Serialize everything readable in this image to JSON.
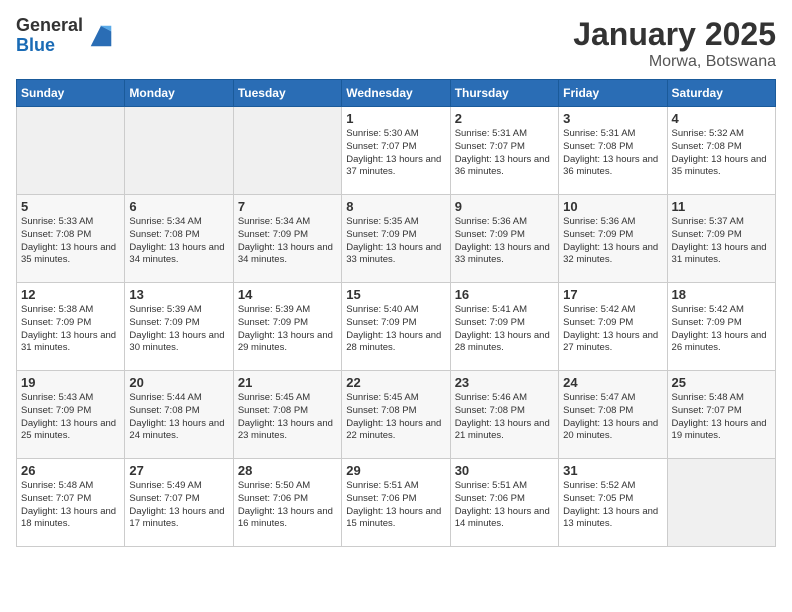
{
  "header": {
    "logo_line1": "General",
    "logo_line2": "Blue",
    "title": "January 2025",
    "subtitle": "Morwa, Botswana"
  },
  "weekdays": [
    "Sunday",
    "Monday",
    "Tuesday",
    "Wednesday",
    "Thursday",
    "Friday",
    "Saturday"
  ],
  "weeks": [
    [
      {
        "day": "",
        "info": ""
      },
      {
        "day": "",
        "info": ""
      },
      {
        "day": "",
        "info": ""
      },
      {
        "day": "1",
        "info": "Sunrise: 5:30 AM\nSunset: 7:07 PM\nDaylight: 13 hours\nand 37 minutes."
      },
      {
        "day": "2",
        "info": "Sunrise: 5:31 AM\nSunset: 7:07 PM\nDaylight: 13 hours\nand 36 minutes."
      },
      {
        "day": "3",
        "info": "Sunrise: 5:31 AM\nSunset: 7:08 PM\nDaylight: 13 hours\nand 36 minutes."
      },
      {
        "day": "4",
        "info": "Sunrise: 5:32 AM\nSunset: 7:08 PM\nDaylight: 13 hours\nand 35 minutes."
      }
    ],
    [
      {
        "day": "5",
        "info": "Sunrise: 5:33 AM\nSunset: 7:08 PM\nDaylight: 13 hours\nand 35 minutes."
      },
      {
        "day": "6",
        "info": "Sunrise: 5:34 AM\nSunset: 7:08 PM\nDaylight: 13 hours\nand 34 minutes."
      },
      {
        "day": "7",
        "info": "Sunrise: 5:34 AM\nSunset: 7:09 PM\nDaylight: 13 hours\nand 34 minutes."
      },
      {
        "day": "8",
        "info": "Sunrise: 5:35 AM\nSunset: 7:09 PM\nDaylight: 13 hours\nand 33 minutes."
      },
      {
        "day": "9",
        "info": "Sunrise: 5:36 AM\nSunset: 7:09 PM\nDaylight: 13 hours\nand 33 minutes."
      },
      {
        "day": "10",
        "info": "Sunrise: 5:36 AM\nSunset: 7:09 PM\nDaylight: 13 hours\nand 32 minutes."
      },
      {
        "day": "11",
        "info": "Sunrise: 5:37 AM\nSunset: 7:09 PM\nDaylight: 13 hours\nand 31 minutes."
      }
    ],
    [
      {
        "day": "12",
        "info": "Sunrise: 5:38 AM\nSunset: 7:09 PM\nDaylight: 13 hours\nand 31 minutes."
      },
      {
        "day": "13",
        "info": "Sunrise: 5:39 AM\nSunset: 7:09 PM\nDaylight: 13 hours\nand 30 minutes."
      },
      {
        "day": "14",
        "info": "Sunrise: 5:39 AM\nSunset: 7:09 PM\nDaylight: 13 hours\nand 29 minutes."
      },
      {
        "day": "15",
        "info": "Sunrise: 5:40 AM\nSunset: 7:09 PM\nDaylight: 13 hours\nand 28 minutes."
      },
      {
        "day": "16",
        "info": "Sunrise: 5:41 AM\nSunset: 7:09 PM\nDaylight: 13 hours\nand 28 minutes."
      },
      {
        "day": "17",
        "info": "Sunrise: 5:42 AM\nSunset: 7:09 PM\nDaylight: 13 hours\nand 27 minutes."
      },
      {
        "day": "18",
        "info": "Sunrise: 5:42 AM\nSunset: 7:09 PM\nDaylight: 13 hours\nand 26 minutes."
      }
    ],
    [
      {
        "day": "19",
        "info": "Sunrise: 5:43 AM\nSunset: 7:09 PM\nDaylight: 13 hours\nand 25 minutes."
      },
      {
        "day": "20",
        "info": "Sunrise: 5:44 AM\nSunset: 7:08 PM\nDaylight: 13 hours\nand 24 minutes."
      },
      {
        "day": "21",
        "info": "Sunrise: 5:45 AM\nSunset: 7:08 PM\nDaylight: 13 hours\nand 23 minutes."
      },
      {
        "day": "22",
        "info": "Sunrise: 5:45 AM\nSunset: 7:08 PM\nDaylight: 13 hours\nand 22 minutes."
      },
      {
        "day": "23",
        "info": "Sunrise: 5:46 AM\nSunset: 7:08 PM\nDaylight: 13 hours\nand 21 minutes."
      },
      {
        "day": "24",
        "info": "Sunrise: 5:47 AM\nSunset: 7:08 PM\nDaylight: 13 hours\nand 20 minutes."
      },
      {
        "day": "25",
        "info": "Sunrise: 5:48 AM\nSunset: 7:07 PM\nDaylight: 13 hours\nand 19 minutes."
      }
    ],
    [
      {
        "day": "26",
        "info": "Sunrise: 5:48 AM\nSunset: 7:07 PM\nDaylight: 13 hours\nand 18 minutes."
      },
      {
        "day": "27",
        "info": "Sunrise: 5:49 AM\nSunset: 7:07 PM\nDaylight: 13 hours\nand 17 minutes."
      },
      {
        "day": "28",
        "info": "Sunrise: 5:50 AM\nSunset: 7:06 PM\nDaylight: 13 hours\nand 16 minutes."
      },
      {
        "day": "29",
        "info": "Sunrise: 5:51 AM\nSunset: 7:06 PM\nDaylight: 13 hours\nand 15 minutes."
      },
      {
        "day": "30",
        "info": "Sunrise: 5:51 AM\nSunset: 7:06 PM\nDaylight: 13 hours\nand 14 minutes."
      },
      {
        "day": "31",
        "info": "Sunrise: 5:52 AM\nSunset: 7:05 PM\nDaylight: 13 hours\nand 13 minutes."
      },
      {
        "day": "",
        "info": ""
      }
    ]
  ]
}
